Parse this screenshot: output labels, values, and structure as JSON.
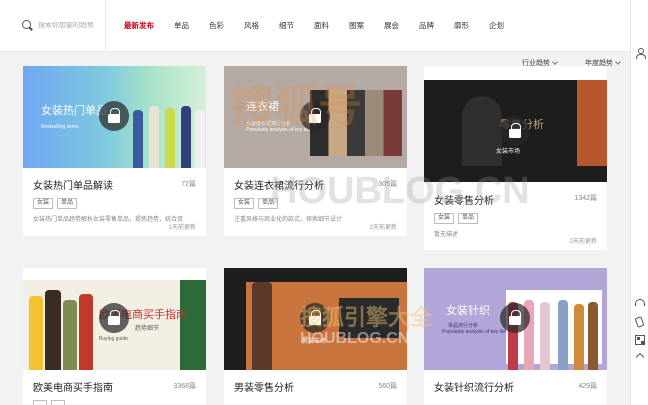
{
  "search": {
    "placeholder": "搜索你想要的趋势"
  },
  "nav": [
    {
      "label": "最新发布",
      "active": true
    },
    {
      "label": "单品"
    },
    {
      "label": "色彩"
    },
    {
      "label": "风格"
    },
    {
      "label": "细节"
    },
    {
      "label": "面料"
    },
    {
      "label": "图案"
    },
    {
      "label": "展会"
    },
    {
      "label": "品牌"
    },
    {
      "label": "廓形"
    },
    {
      "label": "企划"
    }
  ],
  "filters": {
    "industry": "行业趋势",
    "year": "年度趋势"
  },
  "cards": [
    {
      "cover_title": "女装热门单品",
      "cover_sub": "Bestselling items",
      "title": "女装热门单品解读",
      "count": "72篇",
      "tags": [
        "女装",
        "单品"
      ],
      "desc": "女装热门单品趋势解析女装零售单品，提炼趋势，统合资",
      "time": "1天前更新"
    },
    {
      "cover_title": "连衣裙",
      "cover_sub_cn": "女装连衣裙流行分析",
      "cover_sub": "Popularity analysis of key items",
      "title": "女装连衣裙流行分析",
      "count": "305篇",
      "tags": [
        "女装",
        "单品"
      ],
      "desc": "注重风格与商业化的款式，探索细节设计",
      "time": "2天前更新"
    },
    {
      "cover_title": "零售分析",
      "cover_sub": "女装市场",
      "title": "女装零售分析",
      "count": "1342篇",
      "tags": [
        "女装",
        "单品"
      ],
      "desc": "暂无描述",
      "time": "2天前更新"
    },
    {
      "cover_title": "欧美电商买手指南",
      "cover_sub": "趋势细节",
      "cover_sub_en": "Buying guide",
      "title": "欧美电商买手指南",
      "count": "3368篇",
      "tags": [],
      "desc": "",
      "time": ""
    },
    {
      "cover_title": "",
      "cover_sub": "男装市场",
      "title": "男装零售分析",
      "count": "560篇",
      "tags": [],
      "desc": "",
      "time": ""
    },
    {
      "cover_title": "女装针织",
      "cover_sub_cn": "单品流行分析",
      "cover_sub": "Popularity analysis of key items",
      "title": "女装针织流行分析",
      "count": "429篇",
      "tags": [],
      "desc": "",
      "time": ""
    }
  ],
  "watermark": {
    "cn": "搜狐号",
    "en": "HOUBLOG.CN",
    "cn2": "搜狐引擎大全"
  },
  "colors": {
    "accent": "#d0021b"
  },
  "icons": [
    "search-icon",
    "lock-icon",
    "user-icon",
    "headset-icon",
    "phone-icon",
    "qr-icon",
    "back-to-top-icon"
  ]
}
